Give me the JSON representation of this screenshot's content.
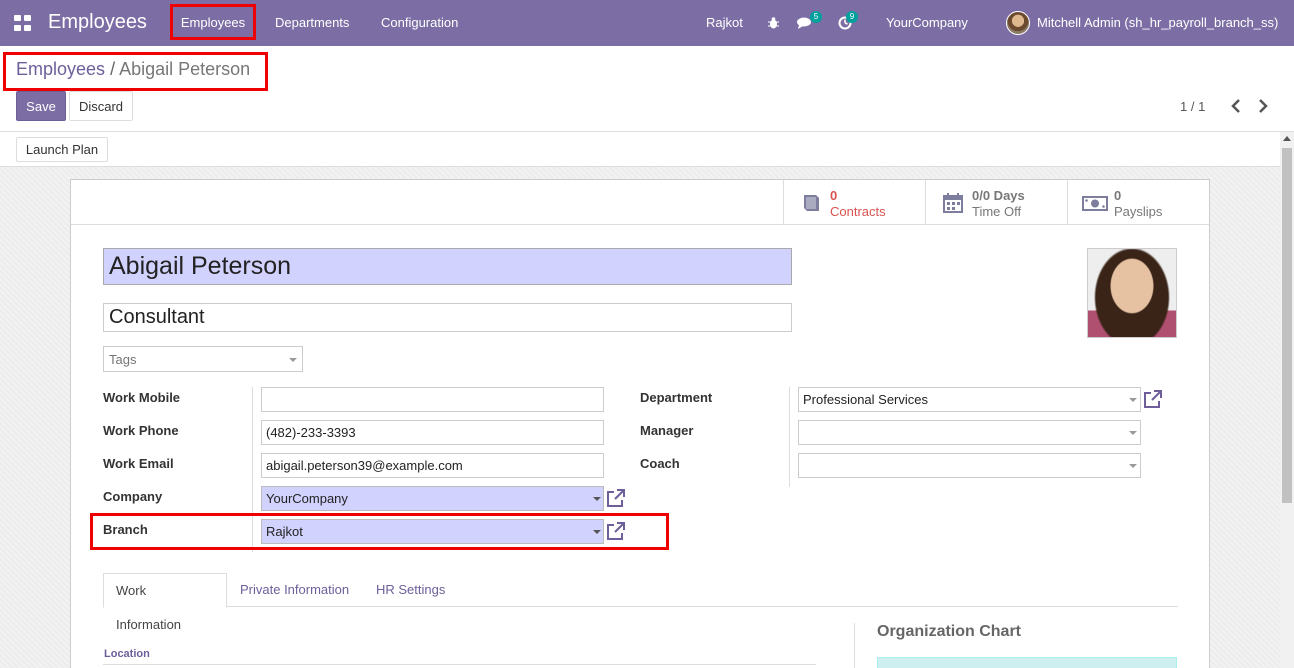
{
  "navbar": {
    "app_title": "Employees",
    "menus": [
      "Employees",
      "Departments",
      "Configuration"
    ],
    "branch": "Rajkot",
    "messages_count": "5",
    "activities_count": "9",
    "company": "YourCompany",
    "user": "Mitchell Admin (sh_hr_payroll_branch_ss)",
    "accent_color": "#7c6ea5"
  },
  "breadcrumb": {
    "parent": "Employees",
    "separator": "/",
    "current": "Abigail Peterson"
  },
  "actions": {
    "save": "Save",
    "discard": "Discard",
    "pager": "1 / 1",
    "launch_plan": "Launch Plan"
  },
  "smart_buttons": [
    {
      "value": "0",
      "label": "Contracts",
      "icon": "book-icon"
    },
    {
      "value": "0/0 Days",
      "label": "Time Off",
      "icon": "calendar-icon"
    },
    {
      "value": "0",
      "label": "Payslips",
      "icon": "money-icon"
    }
  ],
  "employee": {
    "name": "Abigail Peterson",
    "job_title": "Consultant",
    "tags_placeholder": "Tags"
  },
  "left_fields": [
    {
      "label": "Work Mobile",
      "value": ""
    },
    {
      "label": "Work Phone",
      "value": "(482)-233-3393"
    },
    {
      "label": "Work Email",
      "value": "abigail.peterson39@example.com"
    },
    {
      "label": "Company",
      "value": "YourCompany"
    },
    {
      "label": "Branch",
      "value": "Rajkot"
    }
  ],
  "right_fields": [
    {
      "label": "Department",
      "value": "Professional Services"
    },
    {
      "label": "Manager",
      "value": ""
    },
    {
      "label": "Coach",
      "value": ""
    }
  ],
  "tabs": [
    "Work Information",
    "Private Information",
    "HR Settings"
  ],
  "work_info": {
    "location_label": "Location",
    "org_chart_title": "Organization Chart"
  }
}
